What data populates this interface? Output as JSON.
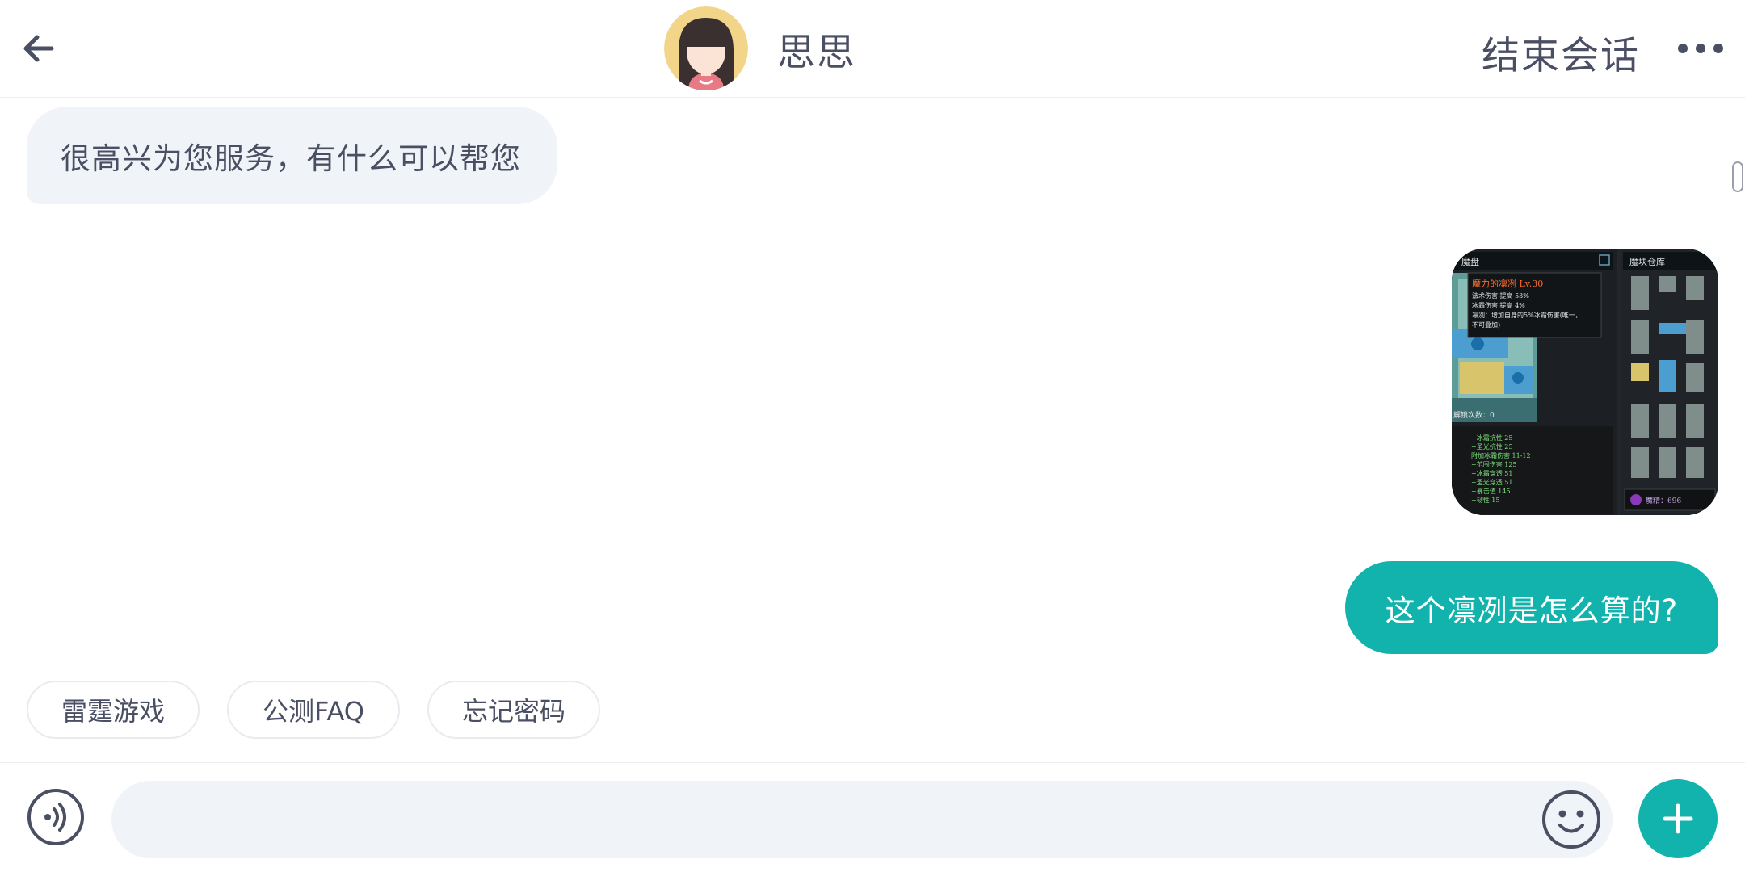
{
  "header": {
    "back_icon": "arrow-left-icon",
    "agent_name": "思思",
    "avatar_icon": "girl-avatar",
    "end_label": "结束会话",
    "more_icon": "more-horizontal-icon"
  },
  "messages": [
    {
      "type": "text",
      "direction": "incoming",
      "text": "很高兴为您服务，有什么可以帮您"
    },
    {
      "type": "image",
      "direction": "outgoing",
      "image": {
        "left_panel_title": "魔盘",
        "right_panel_title": "魔块仓库",
        "tooltip_title": "魔力的凛冽 Lv.30",
        "tooltip_lines": [
          "法术伤害 提高 53%",
          "冰霜伤害 提高 4%",
          "凛冽：增加自身的5%冰霜伤害(唯一，",
          "不可叠加)"
        ],
        "unlock_label": "解锁次数：0",
        "stats_lines": [
          "+冰霜抗性 25",
          "+圣光抗性 25",
          "附加冰霜伤害 11-12",
          "+范围伤害 125",
          "+冰霜穿透 51",
          "+圣光穿透 51",
          "+暴击值 145",
          "+韧性 15"
        ],
        "currency_label": "魔精：696"
      }
    },
    {
      "type": "text",
      "direction": "outgoing",
      "text": "这个凛冽是怎么算的?"
    }
  ],
  "quick_replies": [
    "雷霆游戏",
    "公测FAQ",
    "忘记密码"
  ],
  "input": {
    "placeholder": "",
    "voice_icon": "voice-icon",
    "emoji_icon": "emoji-icon",
    "plus_icon": "plus-icon"
  },
  "colors": {
    "accent": "#13b3ad",
    "bubble_in": "#f0f3f7",
    "text": "#4a4f63"
  }
}
